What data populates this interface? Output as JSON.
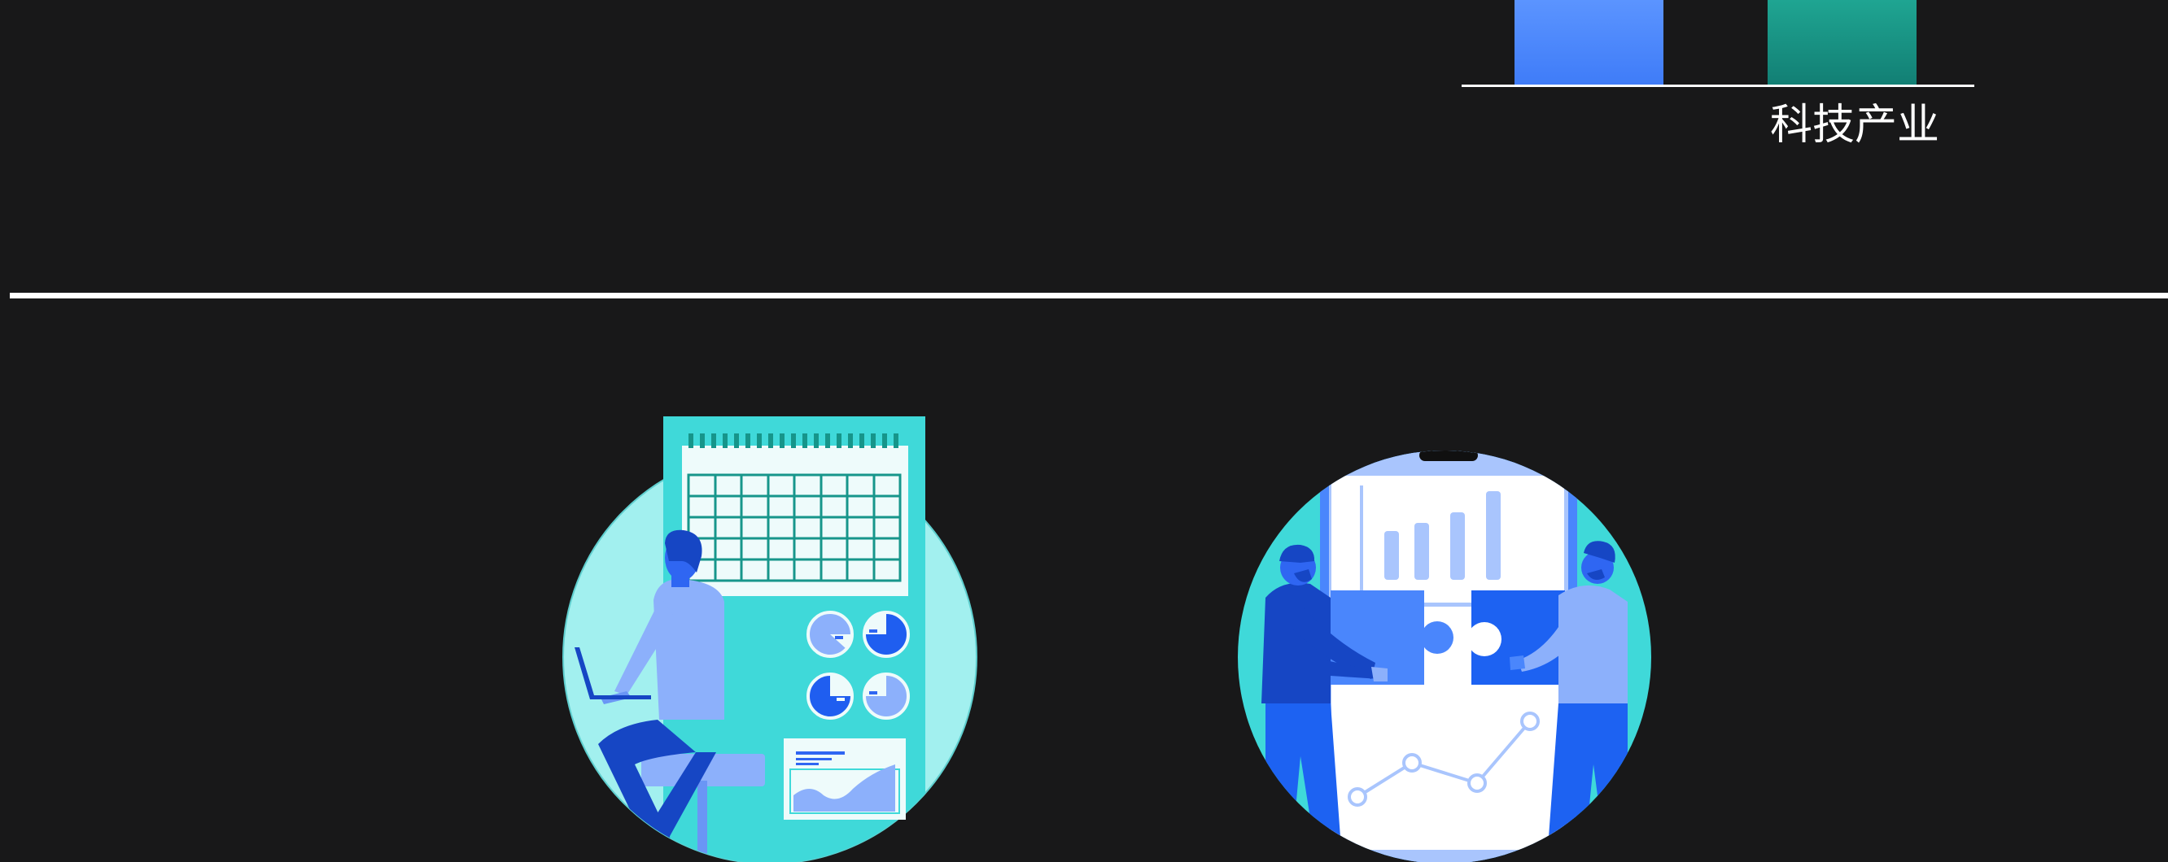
{
  "colors": {
    "background": "#181819",
    "divider": "#ffffff",
    "bar_blue": "#4a86fc",
    "bar_teal": "#1a9886",
    "turquoise": "#3fd9d9",
    "light_turquoise": "#a2f0ef",
    "primary_blue": "#2f66f2",
    "light_blue": "#8cb0fb"
  },
  "chart": {
    "category_label": "科技产业"
  },
  "illustrations": [
    {
      "name": "calendar-analytics",
      "icons": [
        "calendar-icon",
        "pie-chart-icon",
        "area-chart-icon",
        "person-at-laptop-icon"
      ]
    },
    {
      "name": "phone-puzzle-collaboration",
      "icons": [
        "smartphone-icon",
        "puzzle-icon",
        "bar-chart-icon",
        "line-chart-icon",
        "people-icon"
      ]
    }
  ]
}
